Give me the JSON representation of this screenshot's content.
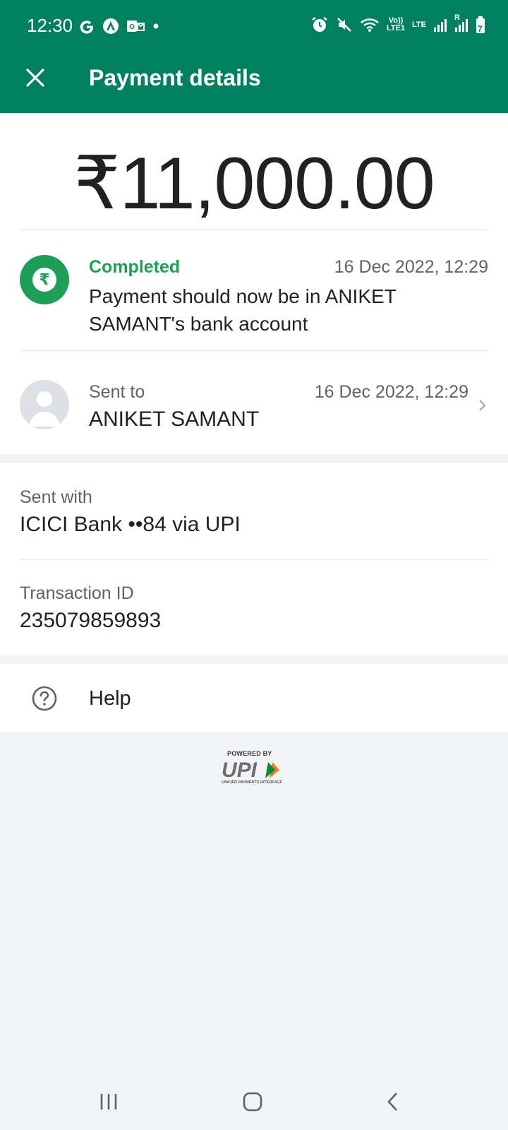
{
  "status_bar": {
    "time": "12:30",
    "left_icons": [
      "google-icon",
      "assistant-icon",
      "outlook-icon",
      "dot-icon"
    ],
    "right_icons": [
      "alarm-icon",
      "mute-icon",
      "wifi-icon",
      "volte-icon",
      "lte-icon",
      "signal-icon",
      "signal-roaming-icon",
      "battery-icon"
    ],
    "volte_label_top": "Vo))",
    "volte_label_bottom": "LTE1",
    "lte_label": "LTE",
    "roaming_label": "R",
    "battery_level": "7"
  },
  "header": {
    "title": "Payment details",
    "close_icon": "close-icon",
    "background_color": "#00805f"
  },
  "payment": {
    "amount": "₹11,000.00",
    "status": {
      "label": "Completed",
      "timestamp": "16 Dec 2022, 12:29",
      "message": "Payment should now be in ANIKET SAMANT's bank account",
      "icon": "rupee-icon",
      "color": "#1e9e57"
    },
    "recipient": {
      "label": "Sent to",
      "name": "ANIKET SAMANT",
      "timestamp": "16 Dec 2022, 12:29",
      "icon": "avatar-icon"
    }
  },
  "details": {
    "sent_with_label": "Sent with",
    "sent_with_value": "ICICI Bank ••84 via UPI",
    "transaction_id_label": "Transaction ID",
    "transaction_id_value": "235079859893"
  },
  "help": {
    "label": "Help",
    "icon": "help-icon"
  },
  "footer": {
    "powered_by": "POWERED BY",
    "logo_text": "UPI",
    "logo_subtitle": "UNIFIED PAYMENTS INTERFACE"
  },
  "nav_bar": {
    "buttons": [
      "recents-icon",
      "home-icon",
      "back-icon"
    ]
  }
}
